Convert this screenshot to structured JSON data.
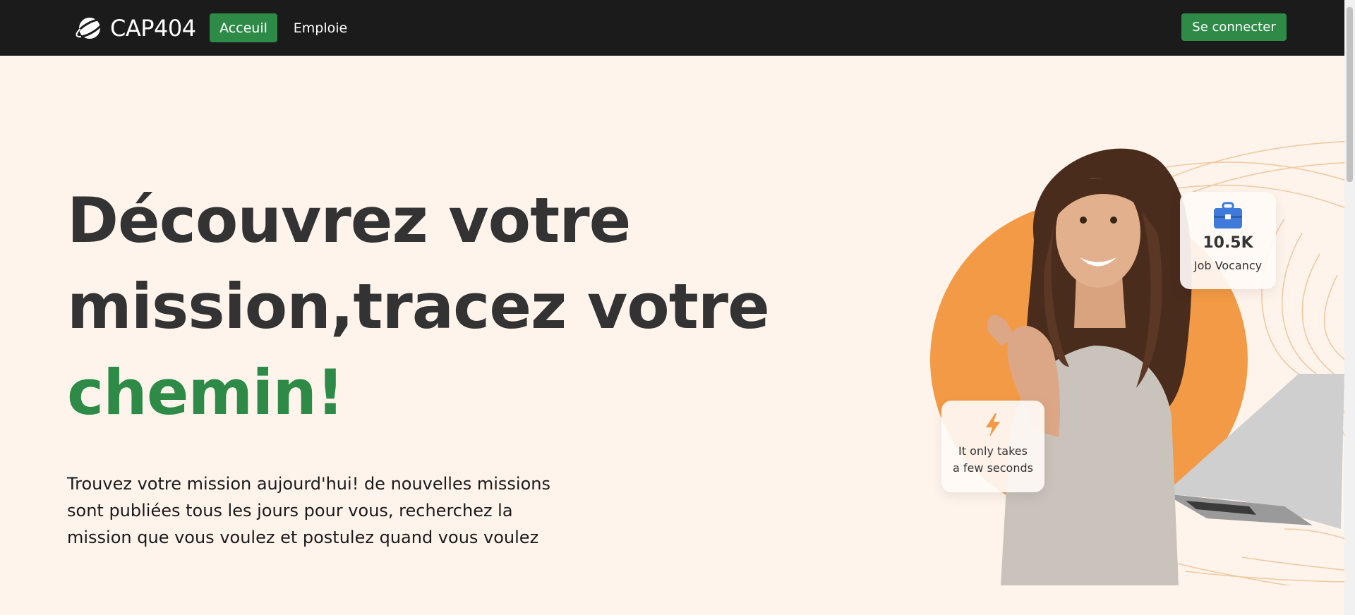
{
  "navbar": {
    "brand": "CAP404",
    "links": [
      {
        "label": "Acceuil",
        "active": true
      },
      {
        "label": "Emploie",
        "active": false
      }
    ],
    "login_label": "Se connecter"
  },
  "hero": {
    "title_line1": "Découvrez votre",
    "title_line2": "mission,tracez votre",
    "title_accent": "chemin!",
    "description": "Trouvez votre mission aujourd'hui! de nouvelles missions sont publiées tous les jours pour vous, recherchez la mission que vous voulez et postulez quand vous voulez"
  },
  "illustration": {
    "jobs_count": "10.5K",
    "jobs_label": "Job Vocancy",
    "fast_label_1": "It only takes",
    "fast_label_2": "a few seconds"
  },
  "colors": {
    "accent": "#2e8b47",
    "navbar": "#1c1b1b",
    "background": "#fff4ec",
    "orange": "#f29a45"
  },
  "icons": {
    "brand": "planet-icon",
    "jobs": "briefcase-icon",
    "fast": "lightning-icon"
  }
}
